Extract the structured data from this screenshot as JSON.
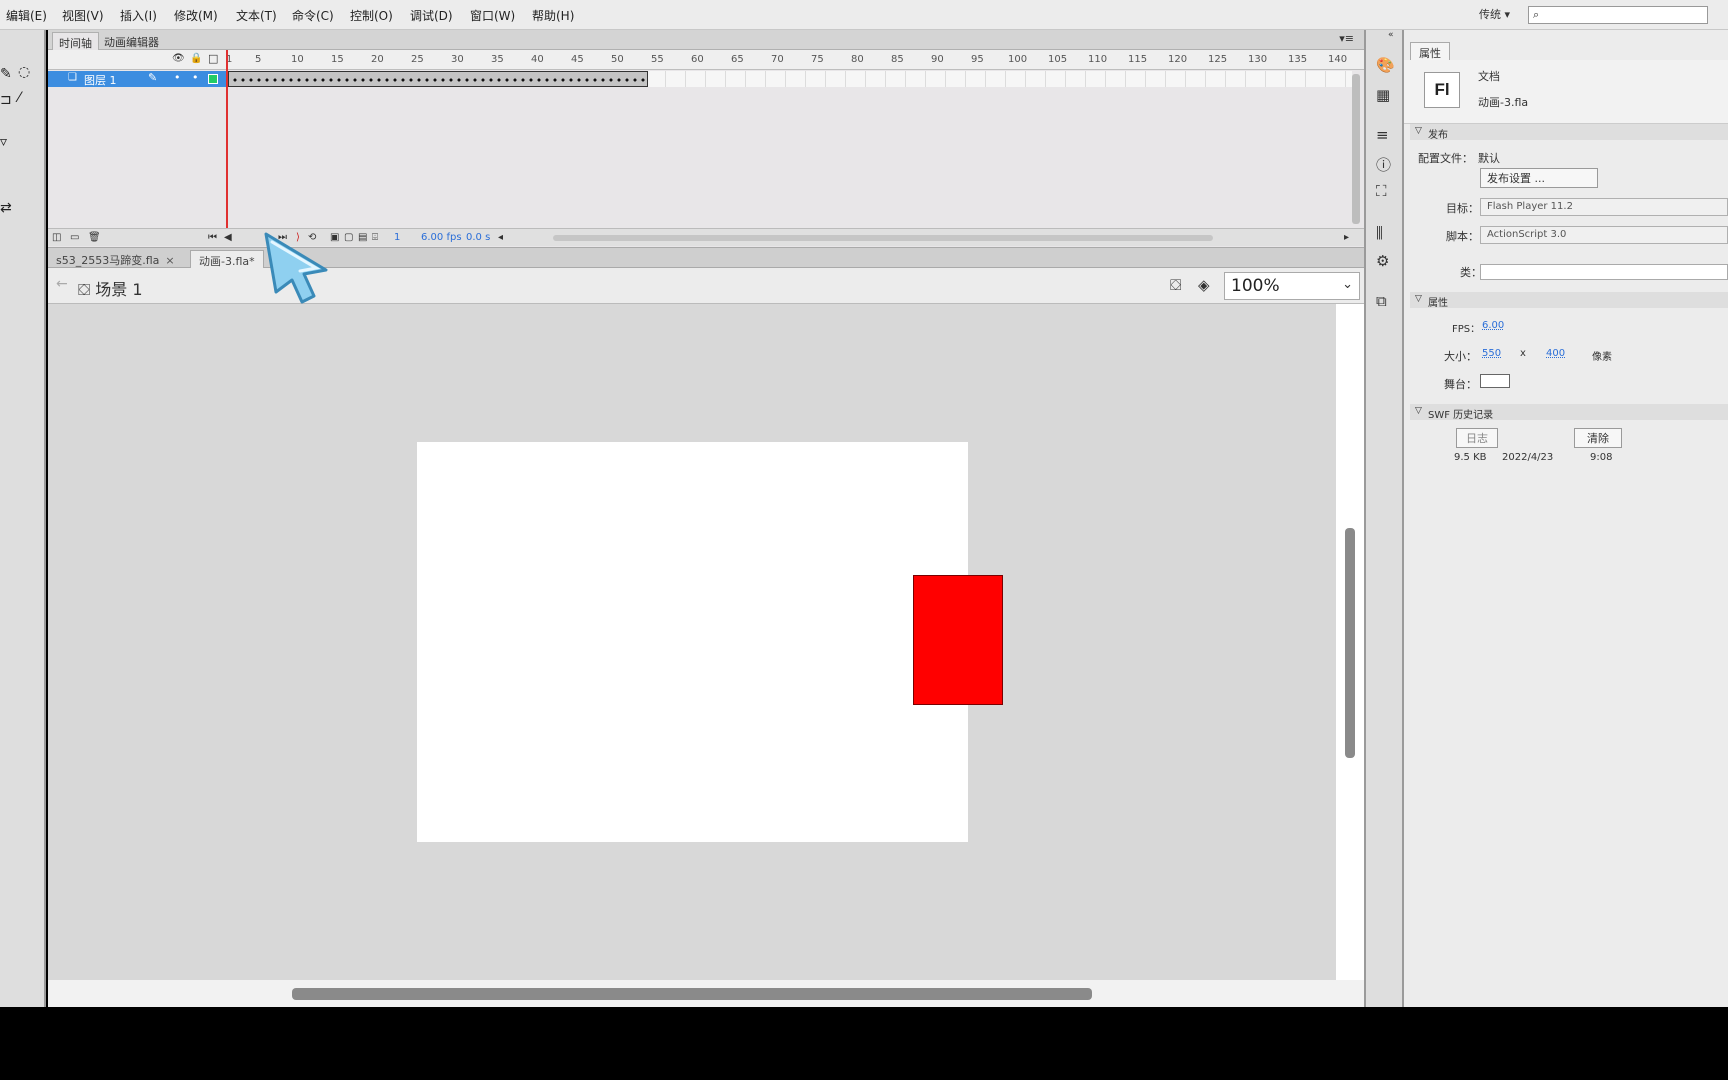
{
  "menu": [
    "编辑(E)",
    "视图(V)",
    "插入(I)",
    "修改(M)",
    "文本(T)",
    "命令(C)",
    "控制(O)",
    "调试(D)",
    "窗口(W)",
    "帮助(H)"
  ],
  "workspace": "传统",
  "timeline": {
    "tabs": [
      "时间轴",
      "动画编辑器"
    ],
    "layer_name": "图层 1",
    "ruler": [
      "1",
      "5",
      "10",
      "15",
      "20",
      "25",
      "30",
      "35",
      "40",
      "45",
      "50",
      "55",
      "60",
      "65",
      "70",
      "75",
      "80",
      "85",
      "90",
      "95",
      "100",
      "105",
      "110",
      "115",
      "120",
      "125",
      "130",
      "135",
      "140"
    ],
    "current_frame": "1",
    "fps": "6.00 fps",
    "time": "0.0 s"
  },
  "doc_tabs": [
    {
      "label": "s53_2553马蹄变.fla",
      "close": "×"
    },
    {
      "label": "动画-3.fla*"
    }
  ],
  "edit_bar": {
    "scene": "场景 1",
    "zoom": "100%"
  },
  "stage": {
    "background": "#ffffff",
    "rect_color": "#ff0000"
  },
  "properties": {
    "tab": "属性",
    "doc_type": "文档",
    "doc_name": "动画-3.fla",
    "publish_section": "发布",
    "profile_label": "配置文件：",
    "profile_value": "默认",
    "publish_settings_button": "发布设置 ...",
    "target_label": "目标：",
    "target_value": "Flash Player 11.2",
    "script_label": "脚本：",
    "script_value": "ActionScript 3.0",
    "class_label": "类：",
    "props_section": "属性",
    "fps_label": "FPS：",
    "fps_value": "6.00",
    "size_label": "大小：",
    "width": "550",
    "x": "x",
    "height": "400",
    "unit": "像素",
    "stage_label": "舞台：",
    "swf_section": "SWF 历史记录",
    "log_button": "日志",
    "clear_button": "清除",
    "swf_size": "9.5 KB",
    "swf_date": "2022/4/23",
    "swf_time": "9:08"
  }
}
